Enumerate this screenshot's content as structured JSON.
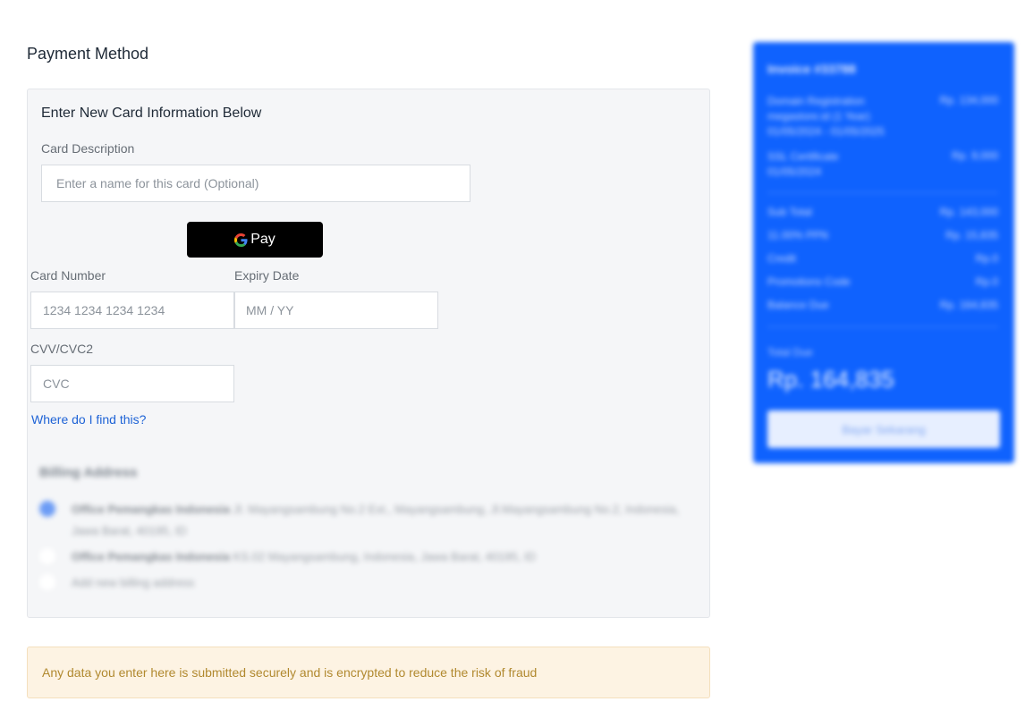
{
  "page": {
    "title": "Payment Method"
  },
  "card_form": {
    "heading": "Enter New Card Information Below",
    "description_label": "Card Description",
    "description_placeholder": "Enter a name for this card (Optional)",
    "gpay_label": "Pay",
    "card_number_label": "Card Number",
    "card_number_placeholder": "1234 1234 1234 1234",
    "expiry_label": "Expiry Date",
    "expiry_placeholder": "MM / YY",
    "cvv_label": "CVV/CVC2",
    "cvv_placeholder": "CVC",
    "help_link": "Where do I find this?"
  },
  "billing": {
    "title": "Billing Address",
    "options": [
      {
        "name": "Office Pemangkas Indonesia",
        "address": "Jl. Mayangsambung No.2 Ext., Mayangsambung, Jl.Mayangsambung No.2, Indonesia, Jawa Barat, 40195, ID",
        "selected": true
      },
      {
        "name": "Office Pemangkas Indonesia",
        "address": "KS.02 Mayangsambung, Indonesia, Jawa Barat, 40195, ID",
        "selected": false
      },
      {
        "name": "",
        "address": "Add new billing address",
        "selected": false
      }
    ]
  },
  "notice": "Any data you enter here is submitted securely and is encrypted to reduce the risk of fraud",
  "summary": {
    "invoice_title": "Invoice #33788",
    "items": [
      {
        "label": "Domain Registration\nmegastore.id (1 Year)\n01/05/2024 - 01/05/2025",
        "value": "Rp. 134,000"
      },
      {
        "label": "SSL Certificate\n01/05/2024",
        "value": "Rp. 9,000"
      }
    ],
    "totals": [
      {
        "label": "Sub Total",
        "value": "Rp. 143,000"
      },
      {
        "label": "11.00% PPN",
        "value": "Rp. 15,835"
      },
      {
        "label": "Credit",
        "value": "Rp.0"
      },
      {
        "label": "Promotions Code",
        "value": "Rp.0"
      },
      {
        "label": "Balance Due",
        "value": "Rp. 164,835"
      }
    ],
    "total_label": "Total Due",
    "total_value": "Rp. 164,835",
    "pay_button": "Bayar Sekarang"
  },
  "colors": {
    "accent": "#0f62fe",
    "link": "#1e63d6",
    "notice_bg": "#fdf3e3",
    "notice_text": "#b1892f"
  }
}
